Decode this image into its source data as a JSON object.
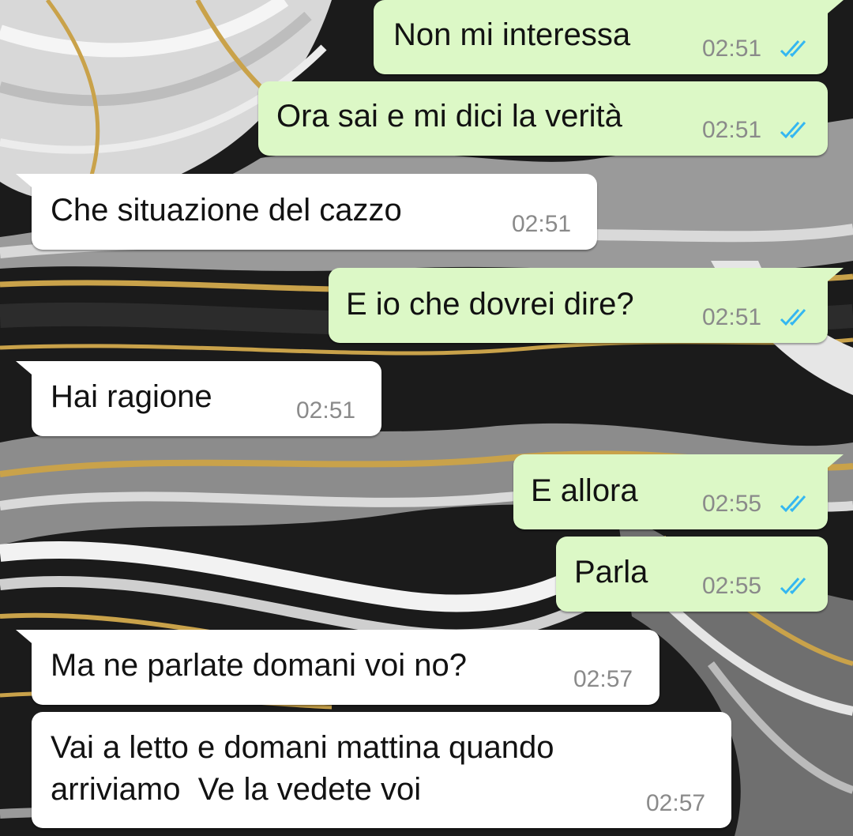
{
  "chat": {
    "messages": [
      {
        "direction": "outgoing",
        "text": "Non mi interessa",
        "time": "02:51",
        "status": "read"
      },
      {
        "direction": "outgoing",
        "text": "Ora sai e mi dici la verità",
        "time": "02:51",
        "status": "read"
      },
      {
        "direction": "incoming",
        "text": "Che situazione del cazzo",
        "time": "02:51"
      },
      {
        "direction": "outgoing",
        "text": "E io che dovrei dire?",
        "time": "02:51",
        "status": "read"
      },
      {
        "direction": "incoming",
        "text": "Hai ragione",
        "time": "02:51"
      },
      {
        "direction": "outgoing",
        "text": "E allora",
        "time": "02:55",
        "status": "read"
      },
      {
        "direction": "outgoing",
        "text": "Parla",
        "time": "02:55",
        "status": "read"
      },
      {
        "direction": "incoming",
        "text": "Ma ne parlate domani voi no?",
        "time": "02:57"
      },
      {
        "direction": "incoming",
        "text_lines": [
          "Vai a letto e domani mattina quando",
          "arriviamo  Ve la vedete voi"
        ],
        "time": "02:57"
      }
    ]
  },
  "colors": {
    "outgoing_bubble": "#dcf8c6",
    "incoming_bubble": "#ffffff",
    "read_ticks": "#34b7f1",
    "timestamp": "#8a8a8a",
    "wallpaper_dark": "#1a1a1a",
    "wallpaper_gold": "#c9a24a"
  },
  "icons": {
    "read_status": "double-check-icon"
  },
  "wallpaper": "black-white-gold-marble"
}
